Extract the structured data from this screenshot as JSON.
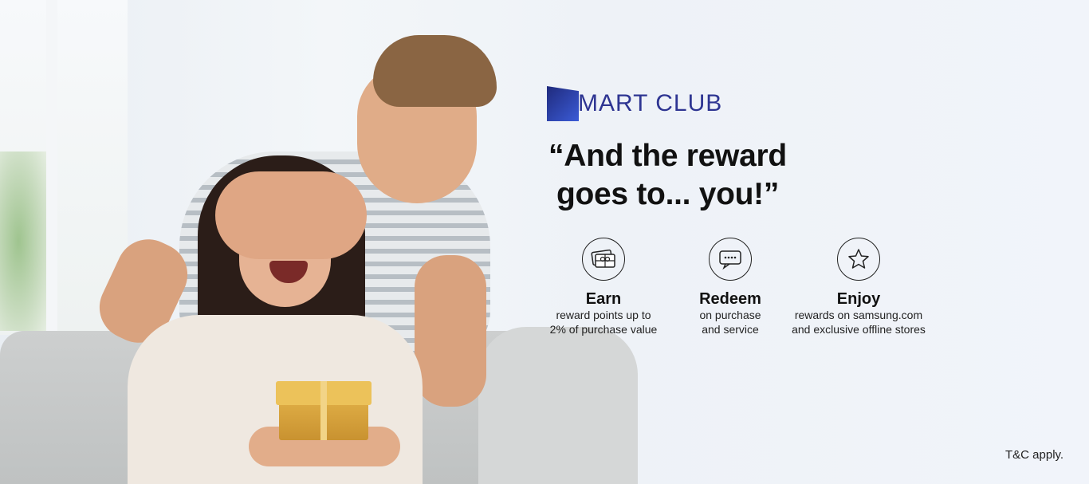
{
  "brand": {
    "logo_first_letter": "S",
    "logo_rest": "MART CLUB",
    "logo_color": "#2e3592"
  },
  "headline": {
    "line1": "“And the reward",
    "line2": "goes to... you!”"
  },
  "features": [
    {
      "icon": "gift-card-icon",
      "title": "Earn",
      "desc_line1": "reward points up to",
      "desc_line2": "2% of purchase value"
    },
    {
      "icon": "chat-bubble-icon",
      "title": "Redeem",
      "desc_line1": "on purchase",
      "desc_line2": "and service"
    },
    {
      "icon": "star-icon",
      "title": "Enjoy",
      "desc_line1": "rewards on samsung.com",
      "desc_line2": "and exclusive offline stores"
    }
  ],
  "footer": {
    "terms": "T&C apply."
  }
}
